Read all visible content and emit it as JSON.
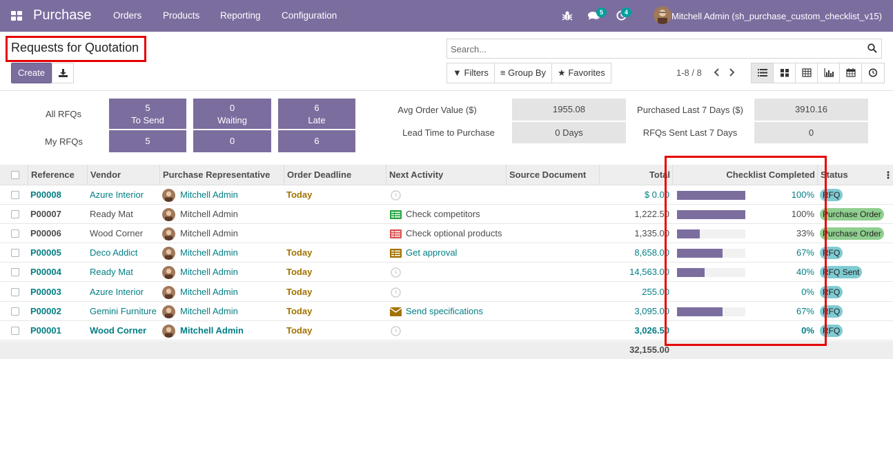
{
  "navbar": {
    "app_name": "Purchase",
    "menus": [
      "Orders",
      "Products",
      "Reporting",
      "Configuration"
    ],
    "messages_count": "5",
    "activities_count": "4",
    "user_name": "Mitchell Admin (sh_purchase_custom_checklist_v15)"
  },
  "control_panel": {
    "title": "Requests for Quotation",
    "create_label": "Create",
    "search_placeholder": "Search...",
    "filters_label": "Filters",
    "group_by_label": "Group By",
    "favorites_label": "Favorites",
    "pager": "1-8 / 8"
  },
  "dashboard": {
    "all_rfqs_label": "All RFQs",
    "my_rfqs_label": "My RFQs",
    "tiles": [
      {
        "count": "5",
        "label": "To Send",
        "my": "5"
      },
      {
        "count": "0",
        "label": "Waiting",
        "my": "0"
      },
      {
        "count": "6",
        "label": "Late",
        "my": "6"
      }
    ],
    "stats": {
      "avg_order_label": "Avg Order Value ($)",
      "avg_order_value": "1955.08",
      "purchased_label": "Purchased Last 7 Days ($)",
      "purchased_value": "3910.16",
      "lead_time_label": "Lead Time to Purchase",
      "lead_time_value": "0  Days",
      "sent_label": "RFQs Sent Last 7 Days",
      "sent_value": "0"
    }
  },
  "table": {
    "headers": [
      "Reference",
      "Vendor",
      "Purchase Representative",
      "Order Deadline",
      "Next Activity",
      "Source Document",
      "Total",
      "Checklist Completed",
      "Status"
    ],
    "rows": [
      {
        "ref": "P00008",
        "vendor": "Azure Interior",
        "rep": "Mitchell Admin",
        "deadline": "Today",
        "activity": "",
        "activity_icon": "clock-icon",
        "total": "$ 0.00",
        "pct": "100%",
        "pct_value": 100,
        "status": "RFQ",
        "status_kind": "rfq",
        "style": "link"
      },
      {
        "ref": "P00007",
        "vendor": "Ready Mat",
        "rep": "Mitchell Admin",
        "deadline": "",
        "activity": "Check competitors",
        "activity_icon": "todo-green-icon",
        "total": "1,222.50",
        "pct": "100%",
        "pct_value": 100,
        "status": "Purchase Order",
        "status_kind": "po",
        "style": "muted"
      },
      {
        "ref": "P00006",
        "vendor": "Wood Corner",
        "rep": "Mitchell Admin",
        "deadline": "",
        "activity": "Check optional products",
        "activity_icon": "todo-red-icon",
        "total": "1,335.00",
        "pct": "33%",
        "pct_value": 33,
        "status": "Purchase Order",
        "status_kind": "po",
        "style": "muted"
      },
      {
        "ref": "P00005",
        "vendor": "Deco Addict",
        "rep": "Mitchell Admin",
        "deadline": "Today",
        "activity": "Get approval",
        "activity_icon": "todo-brown-icon",
        "total": "8,658.00",
        "pct": "67%",
        "pct_value": 67,
        "status": "RFQ",
        "status_kind": "rfq",
        "style": "link"
      },
      {
        "ref": "P00004",
        "vendor": "Ready Mat",
        "rep": "Mitchell Admin",
        "deadline": "Today",
        "activity": "",
        "activity_icon": "clock-icon",
        "total": "14,563.00",
        "pct": "40%",
        "pct_value": 40,
        "status": "RFQ Sent",
        "status_kind": "rfq",
        "style": "link"
      },
      {
        "ref": "P00003",
        "vendor": "Azure Interior",
        "rep": "Mitchell Admin",
        "deadline": "Today",
        "activity": "",
        "activity_icon": "clock-icon",
        "total": "255.00",
        "pct": "0%",
        "pct_value": 0,
        "status": "RFQ",
        "status_kind": "rfq",
        "style": "link"
      },
      {
        "ref": "P00002",
        "vendor": "Gemini Furniture",
        "rep": "Mitchell Admin",
        "deadline": "Today",
        "activity": "Send specifications",
        "activity_icon": "envelope-icon",
        "total": "3,095.00",
        "pct": "67%",
        "pct_value": 67,
        "status": "RFQ",
        "status_kind": "rfq",
        "style": "link"
      },
      {
        "ref": "P00001",
        "vendor": "Wood Corner",
        "rep": "Mitchell Admin",
        "deadline": "Today",
        "activity": "",
        "activity_icon": "clock-icon",
        "total": "3,026.50",
        "pct": "0%",
        "pct_value": 0,
        "status": "RFQ",
        "status_kind": "rfq",
        "style": "link-bold"
      }
    ],
    "grand_total": "32,155.00"
  },
  "colors": {
    "brand": "#7c6d9f",
    "link": "#017e84",
    "today": "#a27200",
    "rfq_badge": "#7fcbd3",
    "po_badge": "#8fcf8f",
    "highlight": "#e60000"
  }
}
